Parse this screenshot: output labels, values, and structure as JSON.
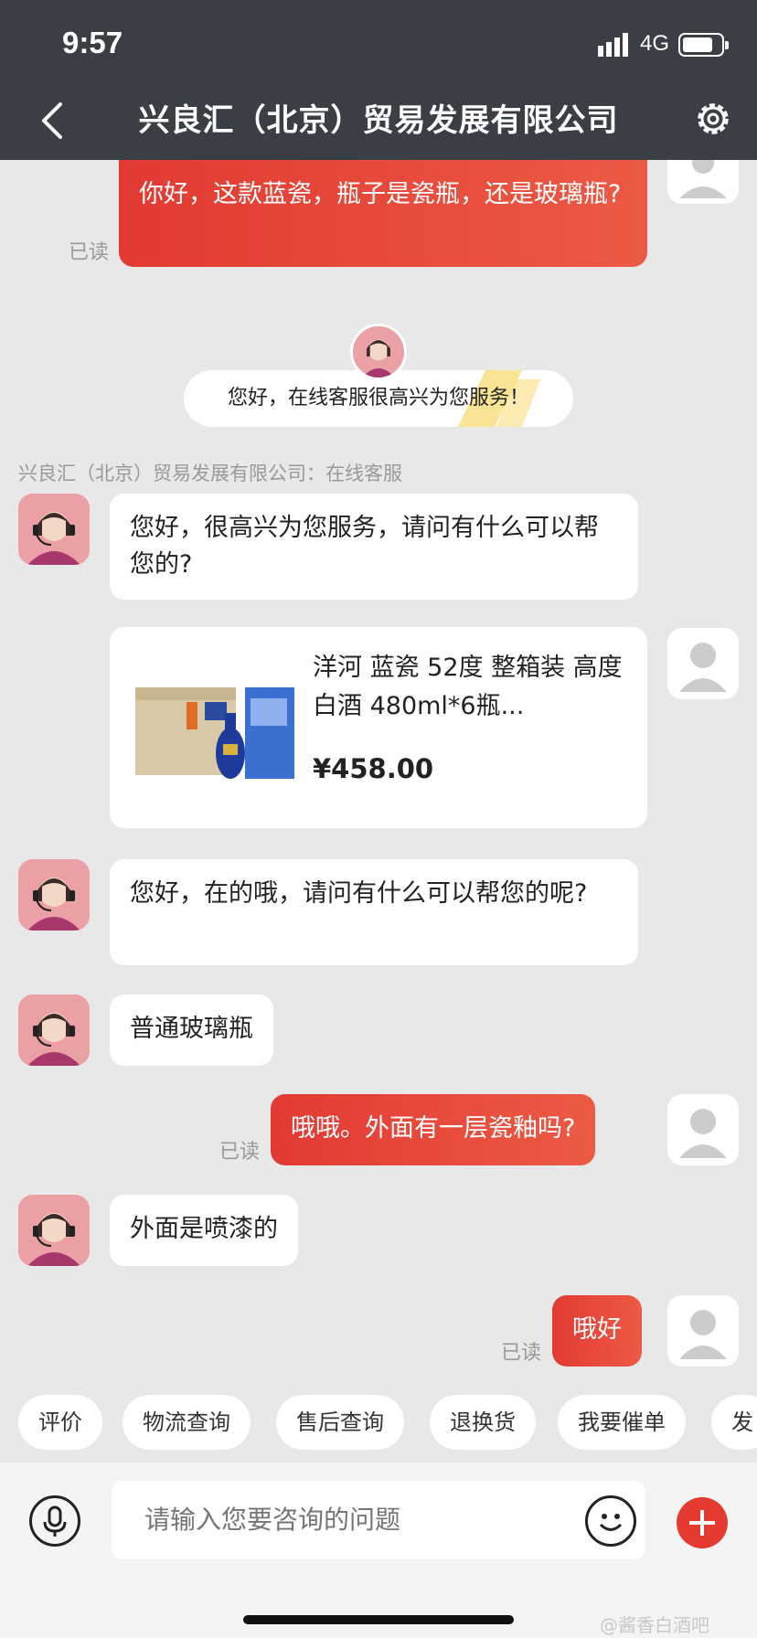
{
  "status_bar": {
    "time": "9:57",
    "network": "4G",
    "battery_level": 0.8
  },
  "header": {
    "title": "兴良汇（北京）贸易发展有限公司"
  },
  "messages": {
    "m1": "你好，这款蓝瓷，瓶子是瓷瓶，还是玻璃瓶?",
    "m1_read": "已读",
    "notice": "您好，在线客服很高兴为您服务！",
    "sender_label": "兴良汇（北京）贸易发展有限公司：在线客服",
    "m2": "您好，很高兴为您服务，请问有什么可以帮您的?",
    "m3": "您好，在的哦，请问有什么可以帮您的呢?",
    "m4": "普通玻璃瓶",
    "m5": "哦哦。外面有一层瓷釉吗?",
    "m5_read": "已读",
    "m6": "外面是喷漆的",
    "m7": "哦好",
    "m7_read": "已读"
  },
  "product": {
    "title": "洋河 蓝瓷 52度 整箱装 高度白酒 480ml*6瓶...",
    "price": "¥458.00"
  },
  "quick_actions": [
    "评价",
    "物流查询",
    "售后查询",
    "退换货",
    "我要催单",
    "发"
  ],
  "composer": {
    "placeholder": "请输入您要咨询的问题"
  },
  "watermark": "@酱香白酒吧",
  "colors": {
    "accent": "#e53a32",
    "header_bg": "#3a3f46",
    "chat_bg": "#e8e8e8"
  }
}
